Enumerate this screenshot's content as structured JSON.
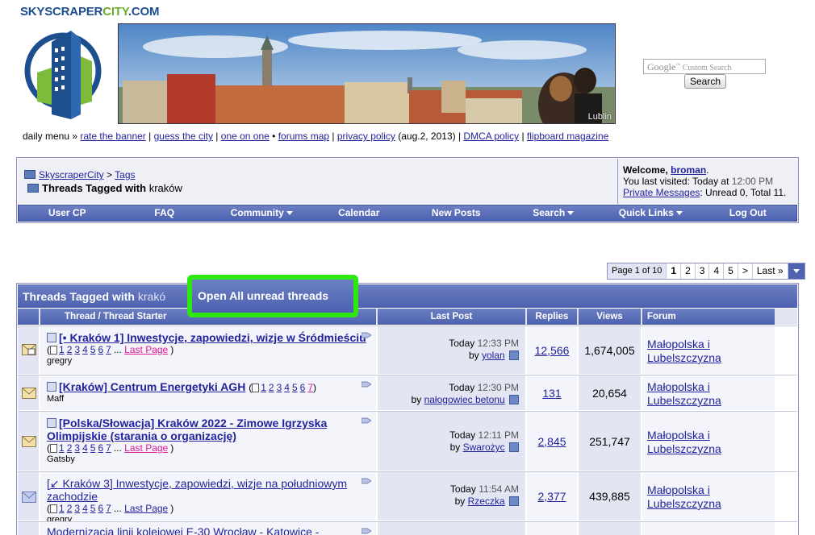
{
  "site": {
    "logo_p1": "SKYSCRAPER",
    "logo_p2": "CITY",
    "logo_p3": ".COM",
    "banner_caption": "Lublin",
    "search_brand": "Google",
    "search_placeholder": "Custom Search",
    "search_button": "Search"
  },
  "daily_menu": {
    "label": "daily menu »",
    "links": [
      "rate the banner",
      "guess the city",
      "one on one",
      "forums map",
      "privacy policy",
      "DMCA policy",
      "flipboard magazine"
    ],
    "privacy_note": "(aug.2, 2013)"
  },
  "breadcrumb": {
    "root": "SkyscraperCity",
    "sep": ">",
    "tags": "Tags",
    "current_prefix": "Threads Tagged with",
    "current_tag": "kraków"
  },
  "welcome": {
    "prefix": "Welcome,",
    "user": "broman",
    "visited": "You last visited: Today at",
    "visited_time": "12:00 PM",
    "pm_link": "Private Messages",
    "pm_text": ": Unread 0, Total 11."
  },
  "navbar": [
    "User CP",
    "FAQ",
    "Community",
    "Calendar",
    "New Posts",
    "Search",
    "Quick Links",
    "Log Out"
  ],
  "pager": {
    "label": "Page 1 of 10",
    "pages": [
      "1",
      "2",
      "3",
      "4",
      "5"
    ],
    "next": ">",
    "last": "Last »"
  },
  "threads": {
    "heading_prefix": "Threads Tagged with",
    "heading_tag": "krakó",
    "open_all": "Open All unread threads",
    "columns": [
      "Thread / Thread Starter",
      "Last Post",
      "Replies",
      "Views",
      "Forum"
    ],
    "rows": [
      {
        "title": "[• Kraków 1] Inwestycje, zapowiedzi, wizje w Śródmieściu",
        "pages": [
          "1",
          "2",
          "3",
          "4",
          "5",
          "6",
          "7"
        ],
        "ellipsis": "...",
        "last_page": "Last Page",
        "starter": "gregry",
        "last_day": "Today",
        "last_time": "12:33 PM",
        "by": "by",
        "last_user": "yolan",
        "replies": "12,566",
        "views": "1,674,005",
        "forum_line1": "Małopolska i",
        "forum_line2": "Lubelszczyzna"
      },
      {
        "title": "[Kraków] Centrum Energetyki AGH",
        "pages": [
          "1",
          "2",
          "3",
          "4",
          "5",
          "6",
          "7"
        ],
        "starter": "Maff",
        "last_day": "Today",
        "last_time": "12:30 PM",
        "by": "by",
        "last_user": "nałogowiec betonu",
        "replies": "131",
        "views": "20,654",
        "forum_line1": "Małopolska i",
        "forum_line2": "Lubelszczyzna"
      },
      {
        "title": "[Polska/Słowacja] Kraków 2022 - Zimowe Igrzyska Olimpijskie (starania o organizację)",
        "pages": [
          "1",
          "2",
          "3",
          "4",
          "5",
          "6",
          "7"
        ],
        "ellipsis": "...",
        "last_page": "Last Page",
        "starter": "Gatsby",
        "last_day": "Today",
        "last_time": "12:11 PM",
        "by": "by",
        "last_user": "Swarożyc",
        "replies": "2,845",
        "views": "251,747",
        "forum_line1": "Małopolska i",
        "forum_line2": "Lubelszczyzna"
      },
      {
        "title": "[↙ Kraków 3] Inwestycje, zapowiedzi, wizje na południowym zachodzie",
        "pages": [
          "1",
          "2",
          "3",
          "4",
          "5",
          "6",
          "7"
        ],
        "ellipsis": "...",
        "last_page": "Last Page",
        "starter": "gregry",
        "last_day": "Today",
        "last_time": "11:54 AM",
        "by": "by",
        "last_user": "Rzeczka",
        "replies": "2,377",
        "views": "439,885",
        "forum_line1": "Małopolska i",
        "forum_line2": "Lubelszczyzna"
      },
      {
        "title": "Modernizacja linii kolejowej E-30 Wrocław - Katowice -"
      }
    ]
  }
}
